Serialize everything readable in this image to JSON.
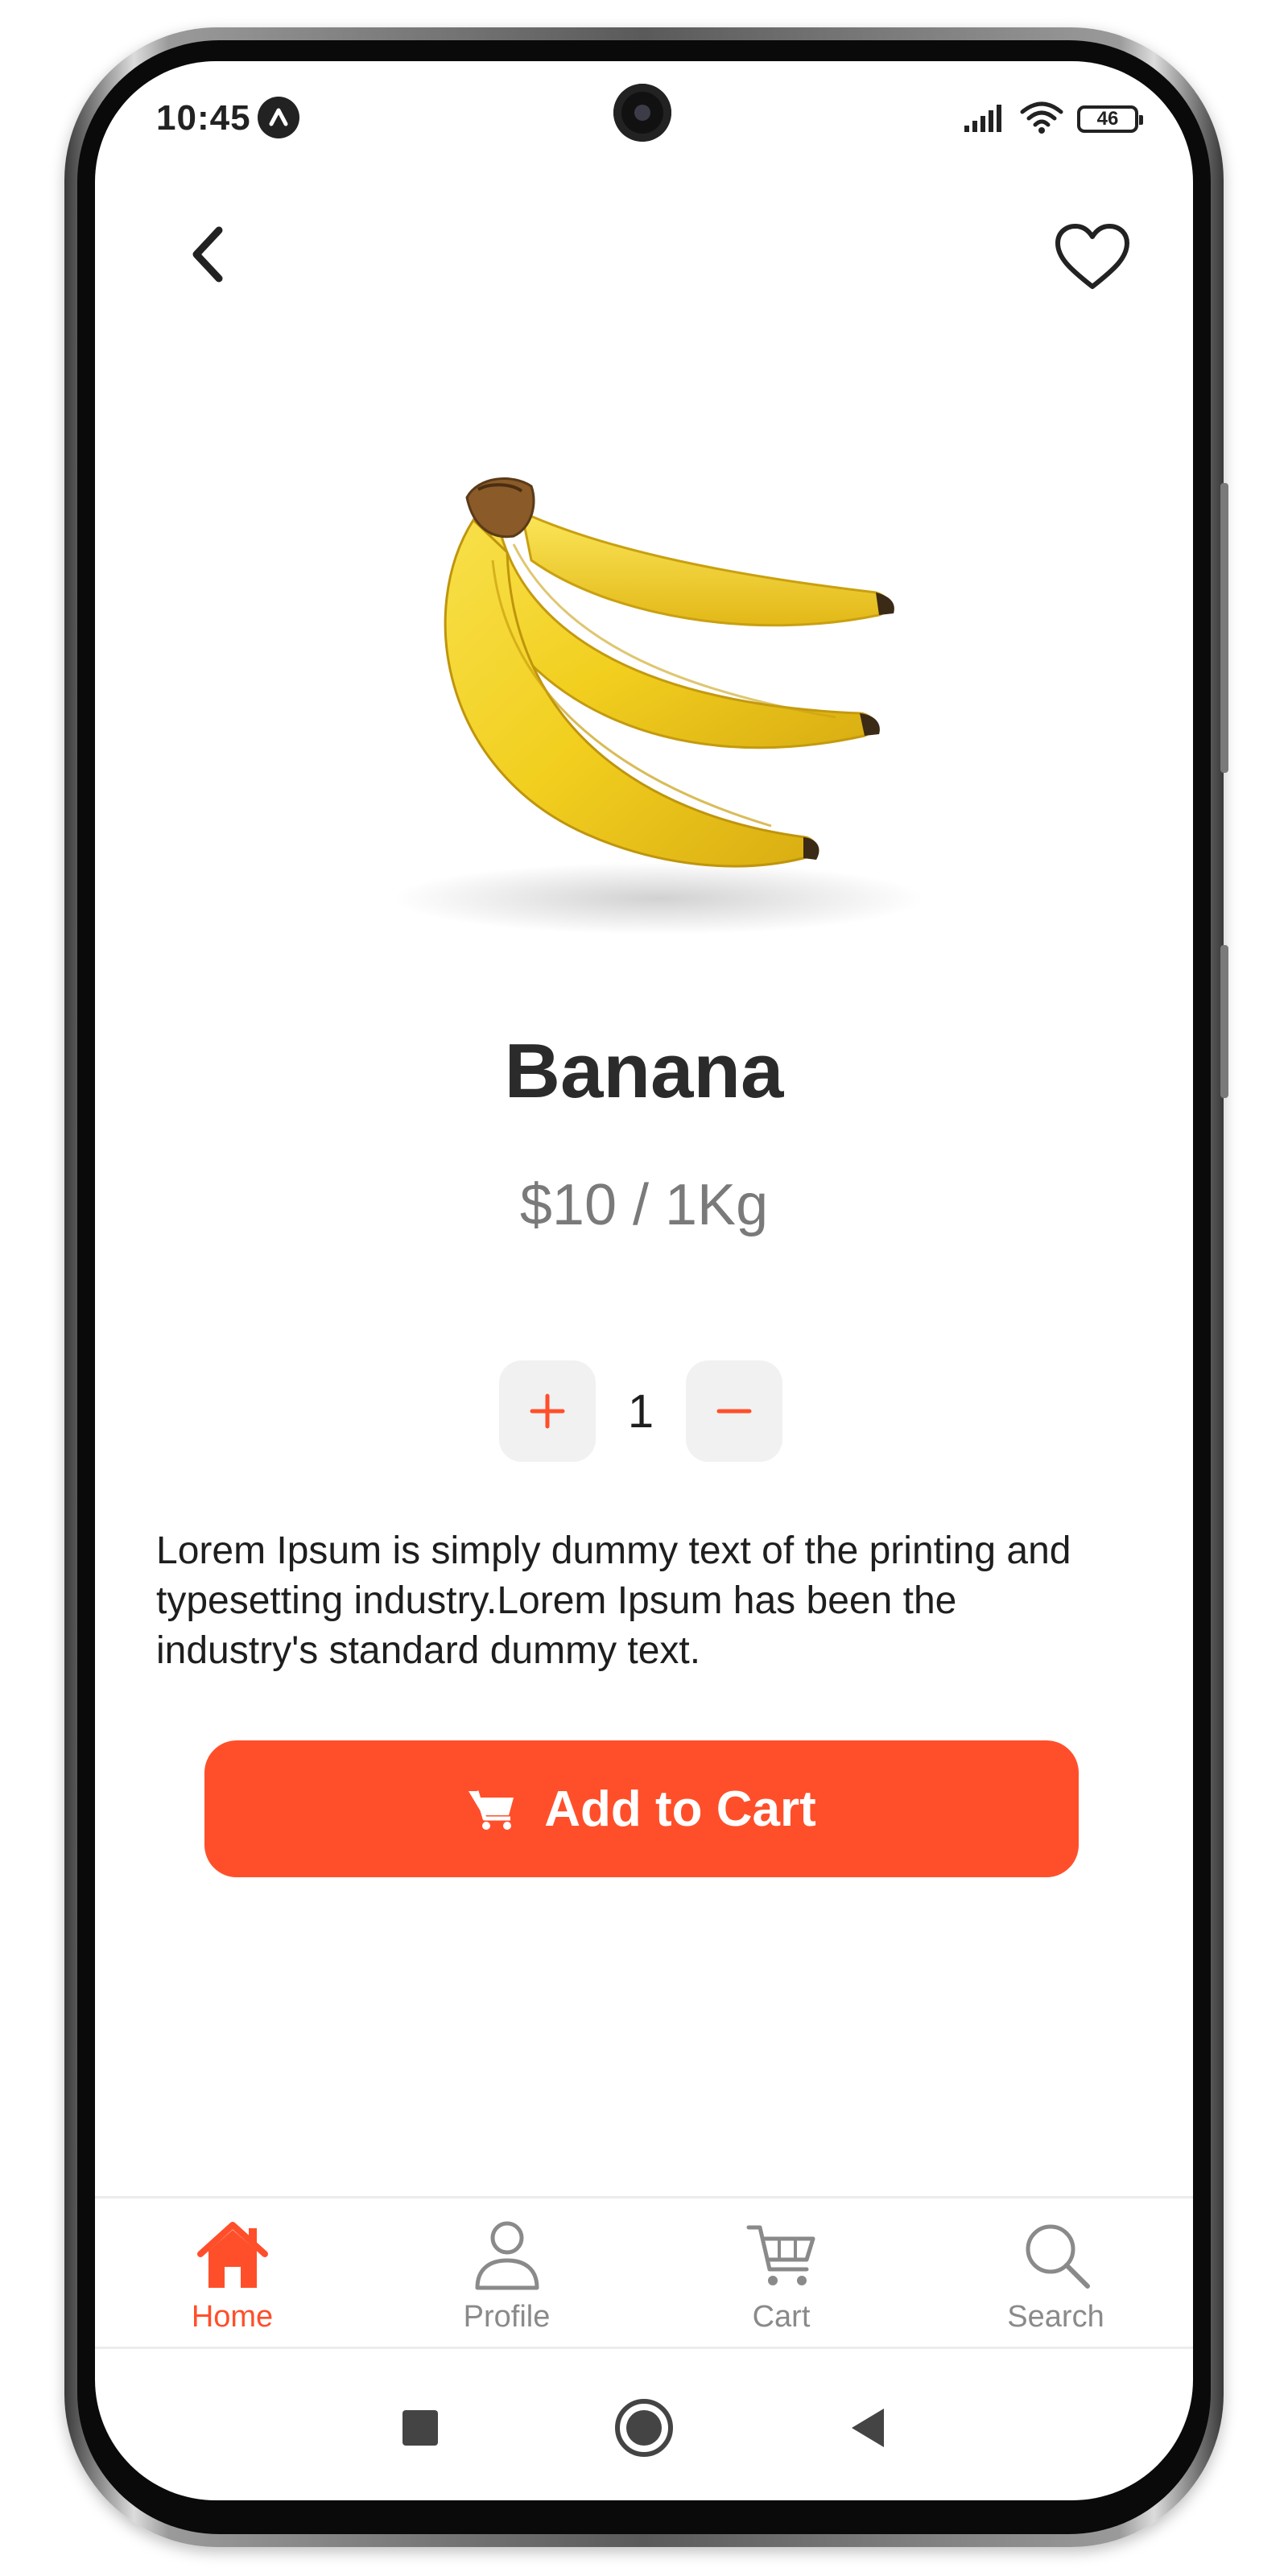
{
  "status_bar": {
    "time": "10:45",
    "battery": "46",
    "icons": [
      "signal-icon",
      "wifi-icon",
      "battery-icon"
    ]
  },
  "header": {
    "back_icon": "chevron-left-icon",
    "favorite_icon": "heart-outline-icon"
  },
  "product": {
    "name": "Banana",
    "price": "$10 / 1Kg",
    "image": "banana-bunch-image",
    "quantity": "1",
    "description": "Lorem Ipsum is simply dummy text of the printing and typesetting industry.Lorem Ipsum has been the industry's standard dummy text."
  },
  "actions": {
    "add_to_cart_label": "Add to Cart",
    "add_to_cart_icon": "cart-icon",
    "increment_icon": "plus-icon",
    "decrement_icon": "minus-icon"
  },
  "tab_bar": {
    "tabs": [
      {
        "label": "Home",
        "icon": "home-icon",
        "active": true
      },
      {
        "label": "Profile",
        "icon": "user-icon",
        "active": false
      },
      {
        "label": "Cart",
        "icon": "cart-icon",
        "active": false
      },
      {
        "label": "Search",
        "icon": "search-icon",
        "active": false
      }
    ]
  },
  "system_nav": {
    "buttons": [
      "recents-square-icon",
      "home-circle-icon",
      "back-triangle-icon"
    ]
  },
  "colors": {
    "accent": "#ff4f2a",
    "title": "#2b2b2b",
    "price": "#7a7a7a",
    "inactive_tab": "#8a8a8a"
  }
}
